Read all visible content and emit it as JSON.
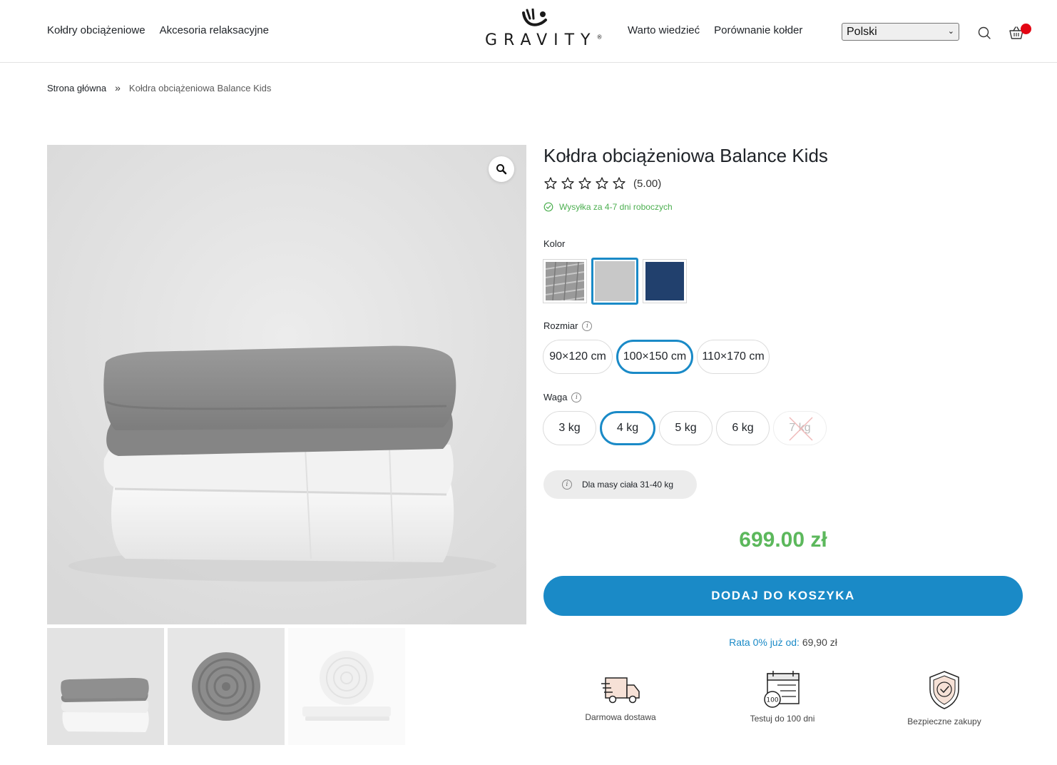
{
  "header": {
    "nav_left": [
      "Kołdry obciążeniowe",
      "Akcesoria relaksacyjne"
    ],
    "logo_text": "GRAVITY",
    "logo_mark": "®",
    "nav_right": [
      "Warto wiedzieć",
      "Porównanie kołder"
    ],
    "language": "Polski",
    "icons": {
      "search": "search-icon",
      "cart": "cart-icon"
    },
    "cart_badge_color": "#e30613"
  },
  "breadcrumb": {
    "home": "Strona główna",
    "separator": "»",
    "current": "Kołdra obciążeniowa Balance Kids"
  },
  "product": {
    "title": "Kołdra obciążeniowa Balance Kids",
    "rating": 5,
    "rating_text": "(5.00)",
    "shipping": "Wysyłka za 4-7 dni roboczych",
    "color_label": "Kolor",
    "colors": [
      {
        "name": "grey-quilted",
        "hex": "#9a9a9a",
        "selected": false
      },
      {
        "name": "light-grey",
        "hex": "#c8c8c8",
        "selected": true
      },
      {
        "name": "navy",
        "hex": "#21406d",
        "selected": false
      }
    ],
    "size_label": "Rozmiar",
    "sizes": [
      "90×120 cm",
      "100×150 cm",
      "110×170 cm"
    ],
    "size_selected": "100×150 cm",
    "weight_label": "Waga",
    "weights": [
      "3 kg",
      "4 kg",
      "5 kg",
      "6 kg",
      "7 kg"
    ],
    "weight_selected": "4 kg",
    "weight_unavailable": "7 kg",
    "body_mass_note": "Dla masy ciała 31-40 kg",
    "price": "699.00 zł",
    "add_to_cart": "DODAJ DO KOSZYKA",
    "installment_lead": "Rata 0% już od:",
    "installment_amount": "69,90 zł",
    "accent_color": "#1a8ac7",
    "price_color": "#5cb85c"
  },
  "features": [
    {
      "label": "Darmowa dostawa",
      "icon": "delivery-truck-icon"
    },
    {
      "label": "Testuj do 100 dni",
      "icon": "calendar-100-icon"
    },
    {
      "label": "Bezpieczne zakupy",
      "icon": "shield-check-icon"
    }
  ],
  "gallery": {
    "thumbnails": [
      "folded-blanket",
      "rolled-grey-blanket",
      "rolled-white-blanket"
    ]
  }
}
